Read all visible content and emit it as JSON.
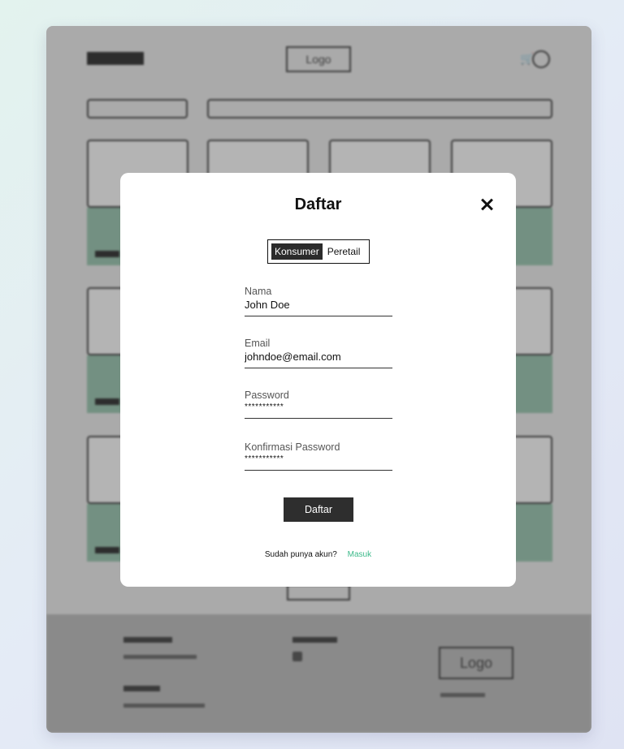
{
  "background": {
    "logo_text": "Logo",
    "footer_logo_text": "Logo",
    "accent_color": "#7fa693"
  },
  "modal": {
    "title": "Daftar",
    "toggle": {
      "active_label": "Konsumer",
      "inactive_label": "Peretail"
    },
    "fields": {
      "name": {
        "label": "Nama",
        "value": "John Doe"
      },
      "email": {
        "label": "Email",
        "value": "johndoe@email.com"
      },
      "password": {
        "label": "Password",
        "value": "***********"
      },
      "confirm_password": {
        "label": "Konfirmasi Password",
        "value": "***********"
      }
    },
    "submit_label": "Daftar",
    "login_prompt": "Sudah punya akun?",
    "login_link": "Masuk",
    "link_color": "#3cb98a"
  }
}
